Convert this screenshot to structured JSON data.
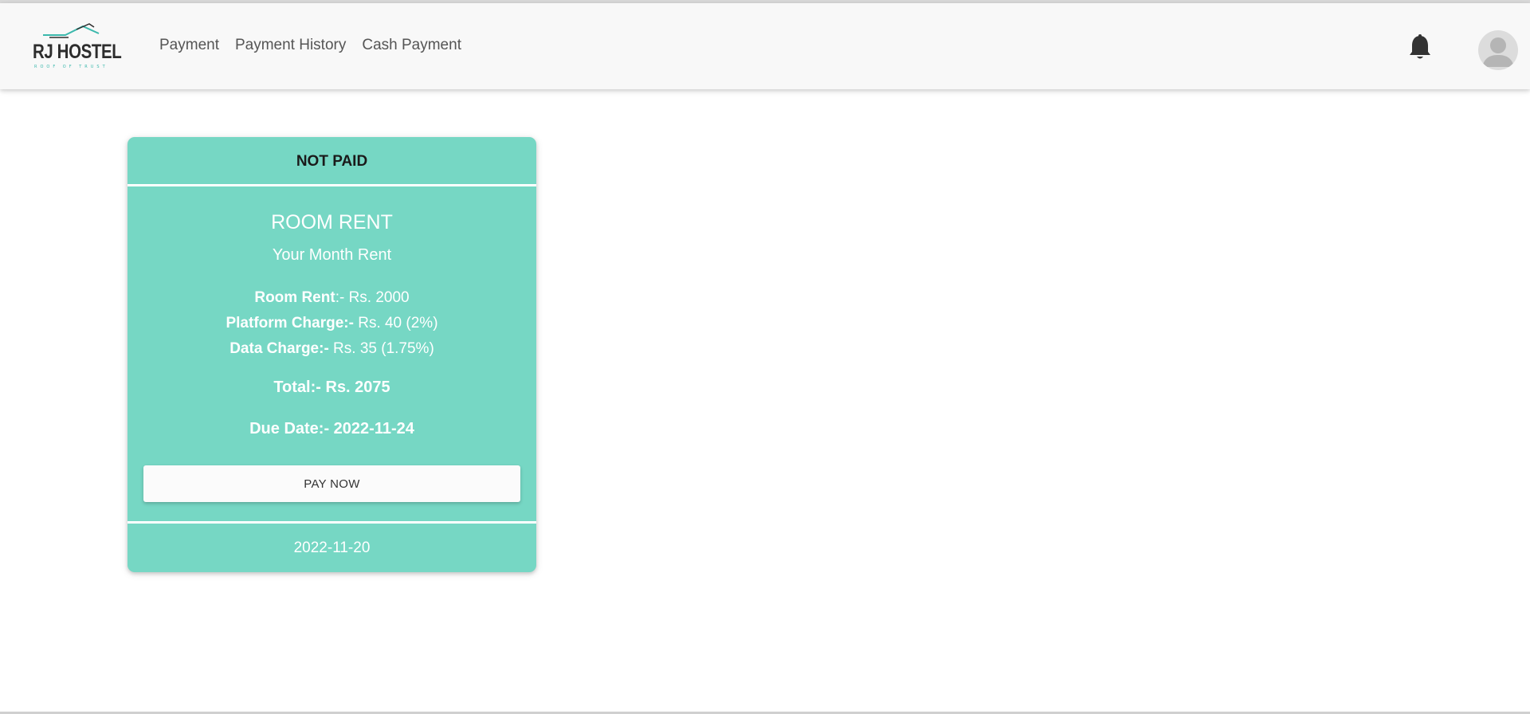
{
  "brand": {
    "name": "RJ HOSTEL",
    "tagline": "ROOF OF TRUST",
    "accent_color": "#3bb8ac"
  },
  "nav": {
    "links": [
      {
        "label": "Payment"
      },
      {
        "label": "Payment History"
      },
      {
        "label": "Cash Payment"
      }
    ],
    "notification_icon": "bell-icon",
    "profile_icon": "user-avatar-icon"
  },
  "payment_card": {
    "status": "NOT PAID",
    "title": "ROOM RENT",
    "subtitle": "Your Month Rent",
    "room_rent": {
      "label": "Room Rent",
      "value": ":- Rs. 2000"
    },
    "platform_charge": {
      "label": "Platform Charge:-",
      "value": " Rs. 40 (2%)"
    },
    "data_charge": {
      "label": "Data Charge:-",
      "value": " Rs. 35 (1.75%)"
    },
    "total": "Total:- Rs. 2075",
    "due_date": "Due Date:- 2022-11-24",
    "pay_button_label": "PAY NOW",
    "footer_date": "2022-11-20",
    "card_color": "#76d7c4"
  }
}
